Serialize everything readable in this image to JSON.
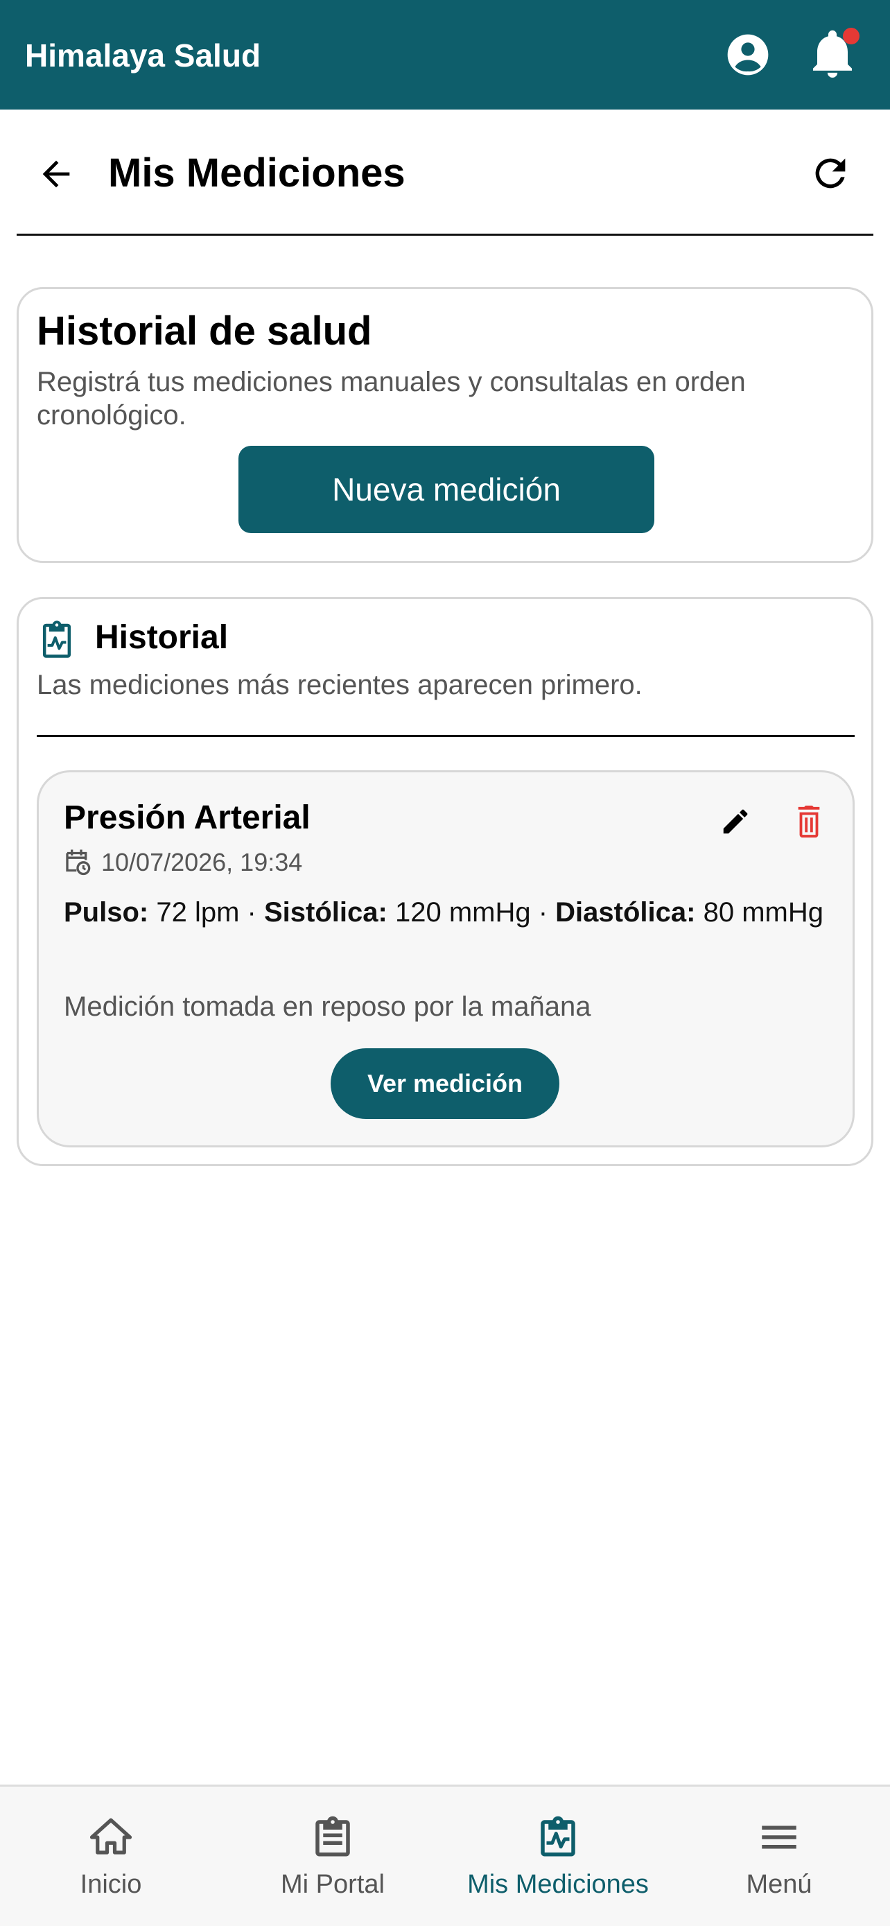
{
  "app": {
    "title": "Himalaya Salud"
  },
  "header": {
    "title": "Mis Mediciones"
  },
  "intro": {
    "title": "Historial de salud",
    "description": "Registrá tus mediciones manuales y consultalas en orden cronológico.",
    "new_button": "Nueva medición"
  },
  "history": {
    "title": "Historial",
    "subtitle": "Las mediciones más recientes aparecen primero.",
    "items": [
      {
        "title": "Presión Arterial",
        "datetime": "10/07/2026, 19:34",
        "pulse_label": "Pulso:",
        "pulse_value": "72 lpm",
        "sep1": "·",
        "sys_label": "Sistólica:",
        "sys_value": "120 mmHg",
        "sep2": "·",
        "dia_label": "Diastólica:",
        "dia_value": "80 mmHg",
        "note": "Medición tomada en reposo por la mañana",
        "view_button": "Ver medición"
      }
    ]
  },
  "nav": {
    "items": [
      {
        "label": "Inicio",
        "icon": "home-icon"
      },
      {
        "label": "Mi Portal",
        "icon": "clipboard-icon"
      },
      {
        "label": "Mis Mediciones",
        "icon": "clipboard-pulse-icon",
        "active": true
      },
      {
        "label": "Menú",
        "icon": "menu-icon"
      }
    ]
  },
  "colors": {
    "primary": "#0e5e6b",
    "danger": "#e53935",
    "notification_dot": "#e53935"
  }
}
